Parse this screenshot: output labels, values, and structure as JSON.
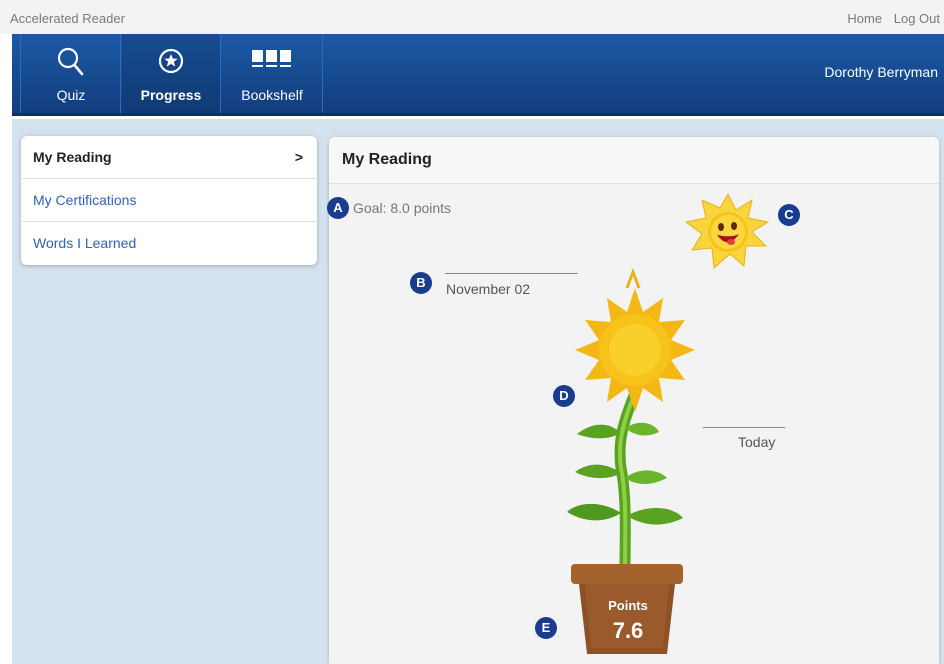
{
  "app": {
    "title": "Accelerated Reader"
  },
  "top_links": {
    "home": "Home",
    "logout": "Log Out"
  },
  "nav": {
    "items": [
      {
        "label": "Quiz",
        "icon": "magnifier-icon"
      },
      {
        "label": "Progress",
        "icon": "star-circle-icon"
      },
      {
        "label": "Bookshelf",
        "icon": "books-icon"
      }
    ],
    "active": "Progress",
    "user_name": "Dorothy Berryman"
  },
  "sidebar": {
    "items": [
      {
        "label": "My Reading",
        "arrow": ">"
      },
      {
        "label": "My Certifications"
      },
      {
        "label": "Words I Learned"
      }
    ]
  },
  "panel": {
    "title": "My Reading",
    "goal": "Goal: 8.0 points",
    "start_date": "November 02",
    "today": "Today",
    "pot_label": "Points",
    "points": "7.6"
  },
  "markers": {
    "a": "A",
    "b": "B",
    "c": "C",
    "d": "D",
    "e": "E"
  },
  "colors": {
    "nav_blue": "#1c5aa6",
    "marker_blue": "#1a3c8e",
    "link_blue": "#2f63b4",
    "petal_yellow": "#f7c21a",
    "stem_green": "#5aa322",
    "pot_brown": "#9a5a2c"
  }
}
